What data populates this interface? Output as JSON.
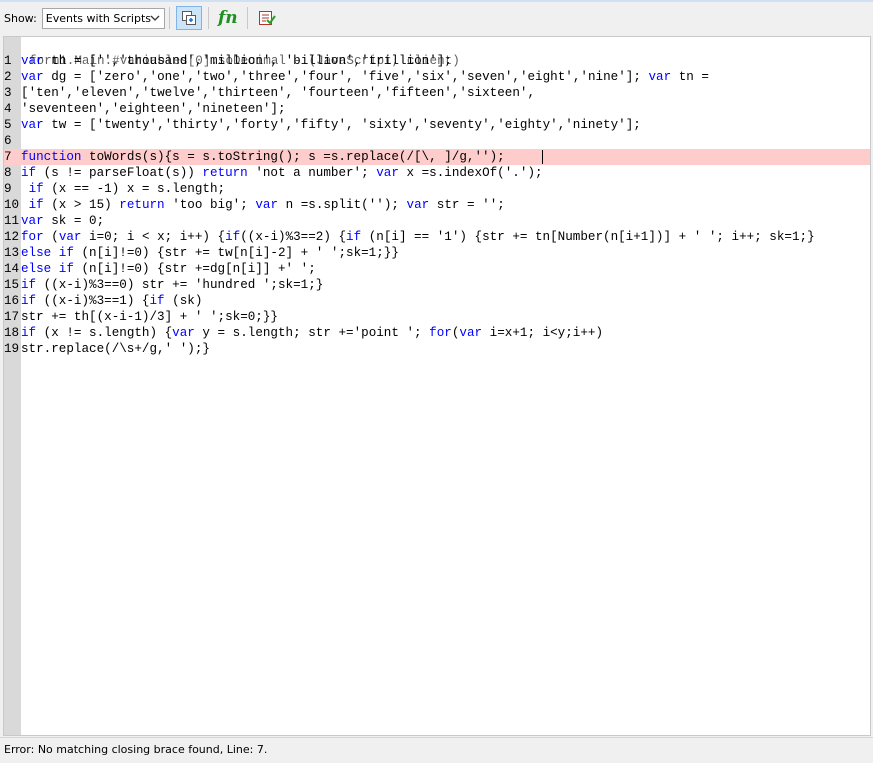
{
  "toolbar": {
    "show_label": "Show:",
    "dropdown_value": "Events with Scripts",
    "buttons": [
      {
        "name": "insert-script-icon",
        "active": true
      },
      {
        "name": "function-icon",
        "glyph": "fn"
      },
      {
        "name": "check-syntax-icon"
      }
    ]
  },
  "editor": {
    "title": "form1.Main.#variables[0].soDecimal - (JavaScript, client)",
    "error_line": 7,
    "lines": [
      {
        "num": "1",
        "code": "var th = ['','thousand','million', 'billion','trillion'];"
      },
      {
        "num": "2",
        "code": "var dg = ['zero','one','two','three','four', 'five','six','seven','eight','nine']; var tn ="
      },
      {
        "num": "3",
        "code": "['ten','eleven','twelve','thirteen', 'fourteen','fifteen','sixteen',"
      },
      {
        "num": "4",
        "code": "'seventeen','eighteen','nineteen'];"
      },
      {
        "num": "5",
        "code": "var tw = ['twenty','thirty','forty','fifty', 'sixty','seventy','eighty','ninety'];"
      },
      {
        "num": "6",
        "code": ""
      },
      {
        "num": "7",
        "code": "function toWords(s){s = s.toString(); s =s.replace(/[\\, ]/g,'');"
      },
      {
        "num": "8",
        "code": "if (s != parseFloat(s)) return 'not a number'; var x =s.indexOf('.');"
      },
      {
        "num": "9",
        "code": " if (x == -1) x = s.length;"
      },
      {
        "num": "10",
        "code": " if (x > 15) return 'too big'; var n =s.split(''); var str = '';"
      },
      {
        "num": "11",
        "code": "var sk = 0;"
      },
      {
        "num": "12",
        "code": "for (var i=0; i < x; i++) {if((x-i)%3==2) {if (n[i] == '1') {str += tn[Number(n[i+1])] + ' '; i++; sk=1;}"
      },
      {
        "num": "13",
        "code": "else if (n[i]!=0) {str += tw[n[i]-2] + ' ';sk=1;}}"
      },
      {
        "num": "14",
        "code": "else if (n[i]!=0) {str +=dg[n[i]] +' ';"
      },
      {
        "num": "15",
        "code": "if ((x-i)%3==0) str += 'hundred ';sk=1;}"
      },
      {
        "num": "16",
        "code": "if ((x-i)%3==1) {if (sk)"
      },
      {
        "num": "17",
        "code": "str += th[(x-i-1)/3] + ' ';sk=0;}}"
      },
      {
        "num": "18",
        "code": "if (x != s.length) {var y = s.length; str +='point '; for(var i=x+1; i<y;i++)"
      },
      {
        "num": "19",
        "code": "str.replace(/\\s+/g,' ');}"
      }
    ]
  },
  "status": {
    "message": "Error: No matching closing brace found, Line: 7."
  },
  "colors": {
    "keyword": "#0000ff",
    "error_highlight": "#ffcccc",
    "gutter": "#d9d9d9"
  }
}
